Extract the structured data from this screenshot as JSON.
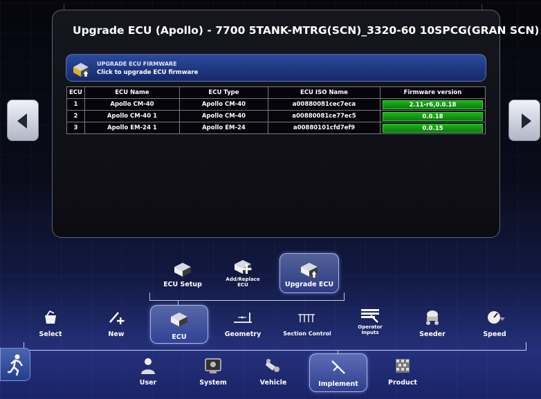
{
  "title": "Upgrade ECU (Apollo) - 7700 5TANK-MTRG(SCN)_3320-60 10SPCG(GRAN SCN)",
  "banner": {
    "heading": "UPGRADE ECU FIRMWARE",
    "subtitle": "Click to upgrade ECU firmware"
  },
  "table": {
    "headers": [
      "ECU",
      "ECU Name",
      "ECU Type",
      "ECU ISO Name",
      "Firmware version"
    ],
    "rows": [
      {
        "ecu": "1",
        "name": "Apollo CM-40",
        "type": "Apollo CM-40",
        "iso": "a00880081cec7eca",
        "fw": "2.11-r6,0.0.18"
      },
      {
        "ecu": "2",
        "name": "Apollo CM-40 1",
        "type": "Apollo CM-40",
        "iso": "a00880081ce77ec5",
        "fw": "0.0.18"
      },
      {
        "ecu": "3",
        "name": "Apollo EM-24 1",
        "type": "Apollo EM-24",
        "iso": "a00880101cfd7ef9",
        "fw": "0.0.15"
      }
    ]
  },
  "submenu": {
    "ecu_setup": "ECU Setup",
    "add_replace_1": "Add/Replace",
    "add_replace_2": "ECU",
    "upgrade_ecu": "Upgrade ECU"
  },
  "menu": {
    "select": "Select",
    "new": "New",
    "ecu": "ECU",
    "geometry": "Geometry",
    "section_control": "Section Control",
    "operator_inputs_1": "Operator",
    "operator_inputs_2": "Inputs",
    "seeder": "Seeder",
    "speed": "Speed"
  },
  "bottom": {
    "user": "User",
    "system": "System",
    "vehicle": "Vehicle",
    "implement": "Implement",
    "product": "Product"
  },
  "colors": {
    "firmware_bar": "#12a012",
    "banner": "#1e3a8a",
    "selected": "#5a6fc0"
  },
  "icons": [
    "arrow-left-icon",
    "arrow-right-icon",
    "ecu-module-icon",
    "run-icon"
  ]
}
